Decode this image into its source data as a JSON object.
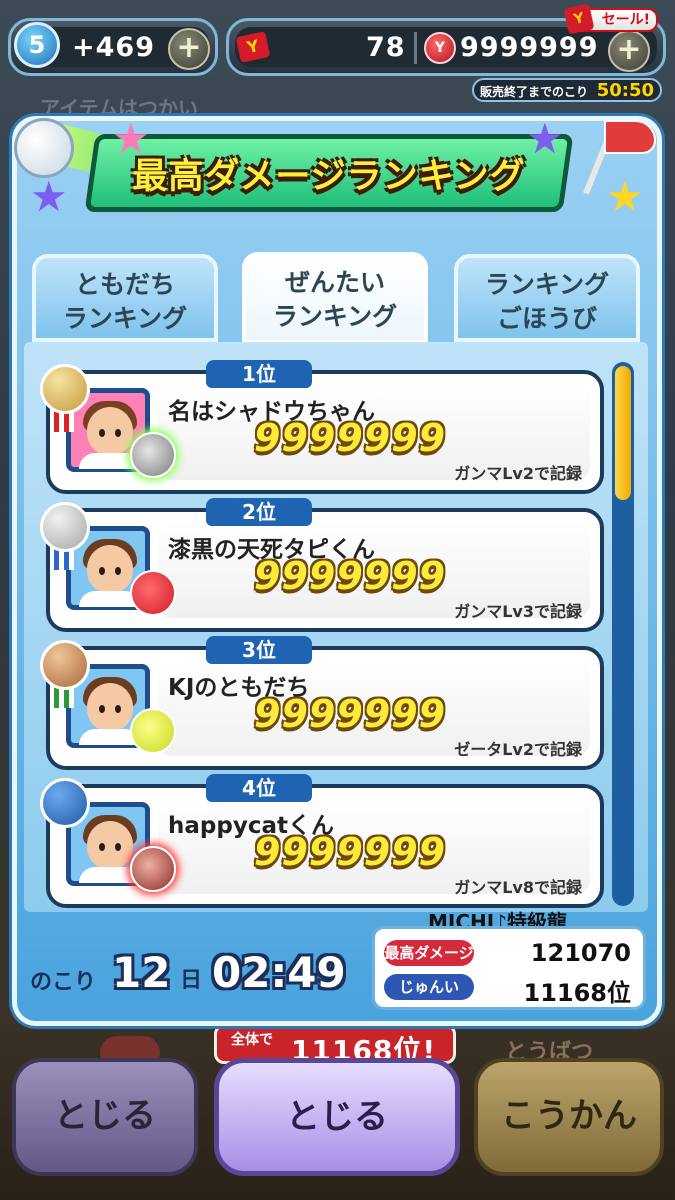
{
  "hud": {
    "spirit_level": "5",
    "spirit_count": "+469",
    "plus_label": "+",
    "tickets": "78",
    "coins": "9999999",
    "sale_label": "セール!",
    "sale_timer_label": "販売終了までのこり",
    "sale_timer_value": "50:50"
  },
  "background": {
    "ghost_text": "アイテムはつかい",
    "banner_small": "全体で",
    "banner_big": "11168位!",
    "right_text": "とうばつ"
  },
  "title": "最高ダメージランキング",
  "tabs": [
    {
      "line1": "ともだち",
      "line2": "ランキング",
      "active": false
    },
    {
      "line1": "ぜんたい",
      "line2": "ランキング",
      "active": true
    },
    {
      "line1": "ランキング",
      "line2": "ごほうび",
      "active": false
    }
  ],
  "rankings": [
    {
      "rank": "1位",
      "name": "名はシャドウちゃん",
      "score": "9999999",
      "record": "ガンマLv2で記録",
      "medal": "gold-medal"
    },
    {
      "rank": "2位",
      "name": "漆黒の天死タピくん",
      "score": "9999999",
      "record": "ガンマLv3で記録",
      "medal": "silver-medal"
    },
    {
      "rank": "3位",
      "name": "KJのともだち",
      "score": "9999999",
      "record": "ゼータLv2で記録",
      "medal": "bronze-medal"
    },
    {
      "rank": "4位",
      "name": "happycatくん",
      "score": "9999999",
      "record": "ガンマLv8で記録",
      "medal": "blue-medal"
    }
  ],
  "remaining": {
    "label": "のこり",
    "days": "12",
    "day_unit": "日",
    "time": "02:49"
  },
  "my_record": {
    "name": "MICHI♪特級龍",
    "best_damage_label": "最高ダメージ",
    "best_damage_value": "121070",
    "rank_label": "じゅんい",
    "rank_value": "11168位"
  },
  "buttons": {
    "left": "とじる",
    "center": "とじる",
    "right": "こうかん"
  },
  "colors": {
    "panel_blue": "#4aa3dd",
    "title_green": "#1fbf7a",
    "score_yellow": "#ffe93a",
    "rank_tab_blue": "#1f63b3"
  }
}
